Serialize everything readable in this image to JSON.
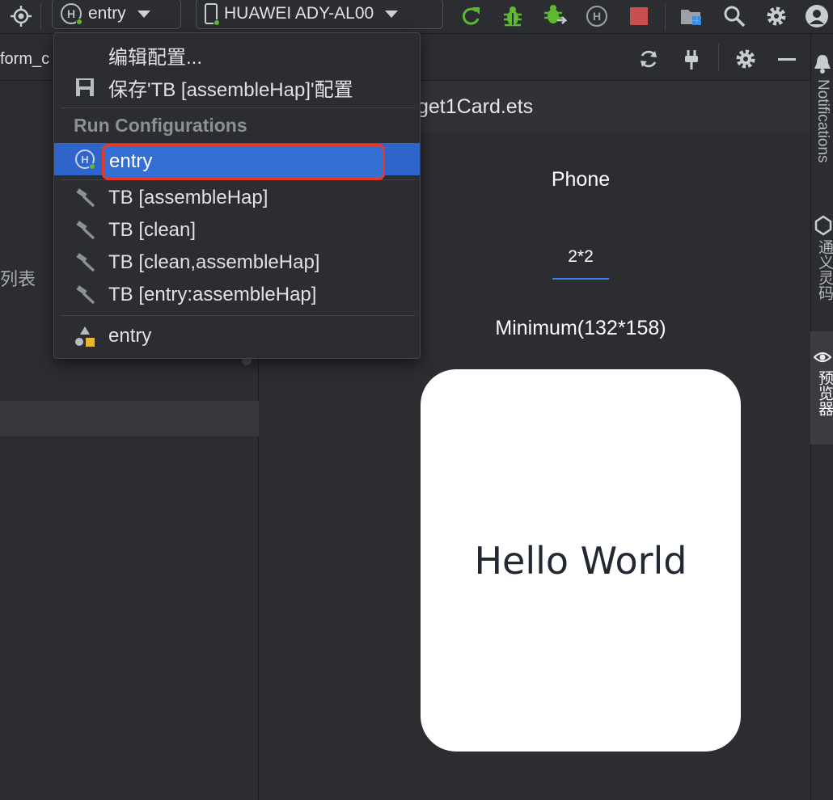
{
  "toolbar": {
    "run_config": "entry",
    "device": "HUAWEI ADY-AL00",
    "icons": [
      "target-icon",
      "harmony-icon",
      "phone-icon",
      "rerun-icon",
      "debug-icon",
      "attach-debugger-icon",
      "profile-icon",
      "stop-icon",
      "project-structure-icon",
      "search-icon",
      "settings-icon",
      "user-icon"
    ],
    "colors": {
      "run_green": "#5fb832",
      "stop_red": "#c94f4f"
    }
  },
  "left_panel": {
    "tab_text": "form_c",
    "list_text": "列表"
  },
  "dropdown": {
    "edit_config": "编辑配置...",
    "save_config": "保存'TB [assembleHap]'配置",
    "section_header": "Run Configurations",
    "selected_item": "entry",
    "items": [
      "TB [assembleHap]",
      "TB [clean]",
      "TB [clean,assembleHap]",
      "TB [entry:assembleHap]"
    ],
    "module_item": "entry",
    "colors": {
      "selected_bg": "#2f65ca",
      "highlight_border": "#e8382c"
    }
  },
  "preview": {
    "file_name": "get1Card.ets",
    "device_type": "Phone",
    "card_size": "2*2",
    "size_label": "Minimum(132*158)",
    "card_text": "Hello World"
  },
  "right_strip": {
    "notifications": "Notifications",
    "tongyi": "通义灵码",
    "previewer": "预览器"
  }
}
